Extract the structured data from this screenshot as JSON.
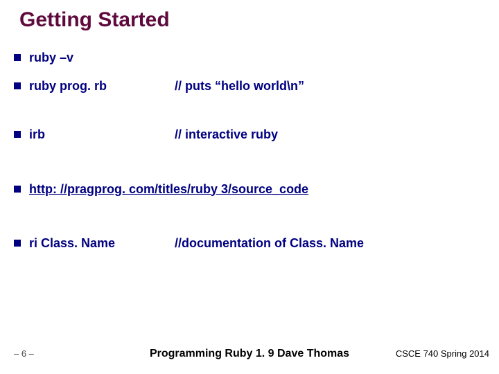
{
  "title": "Getting Started",
  "items": [
    {
      "cmd": "ruby –v",
      "comment": ""
    },
    {
      "cmd": "ruby prog. rb",
      "comment": "// puts “hello world\\n”"
    },
    {
      "cmd": "irb",
      "comment": "// interactive ruby"
    },
    {
      "cmd": "http: //pragprog. com/titles/ruby 3/source_code",
      "comment": "",
      "link": true
    },
    {
      "cmd": "ri Class. Name",
      "comment": "//documentation of Class. Name"
    }
  ],
  "footer": {
    "page": "– 6 –",
    "center": "Programming Ruby 1. 9 Dave Thomas",
    "right": "CSCE 740 Spring 2014"
  }
}
